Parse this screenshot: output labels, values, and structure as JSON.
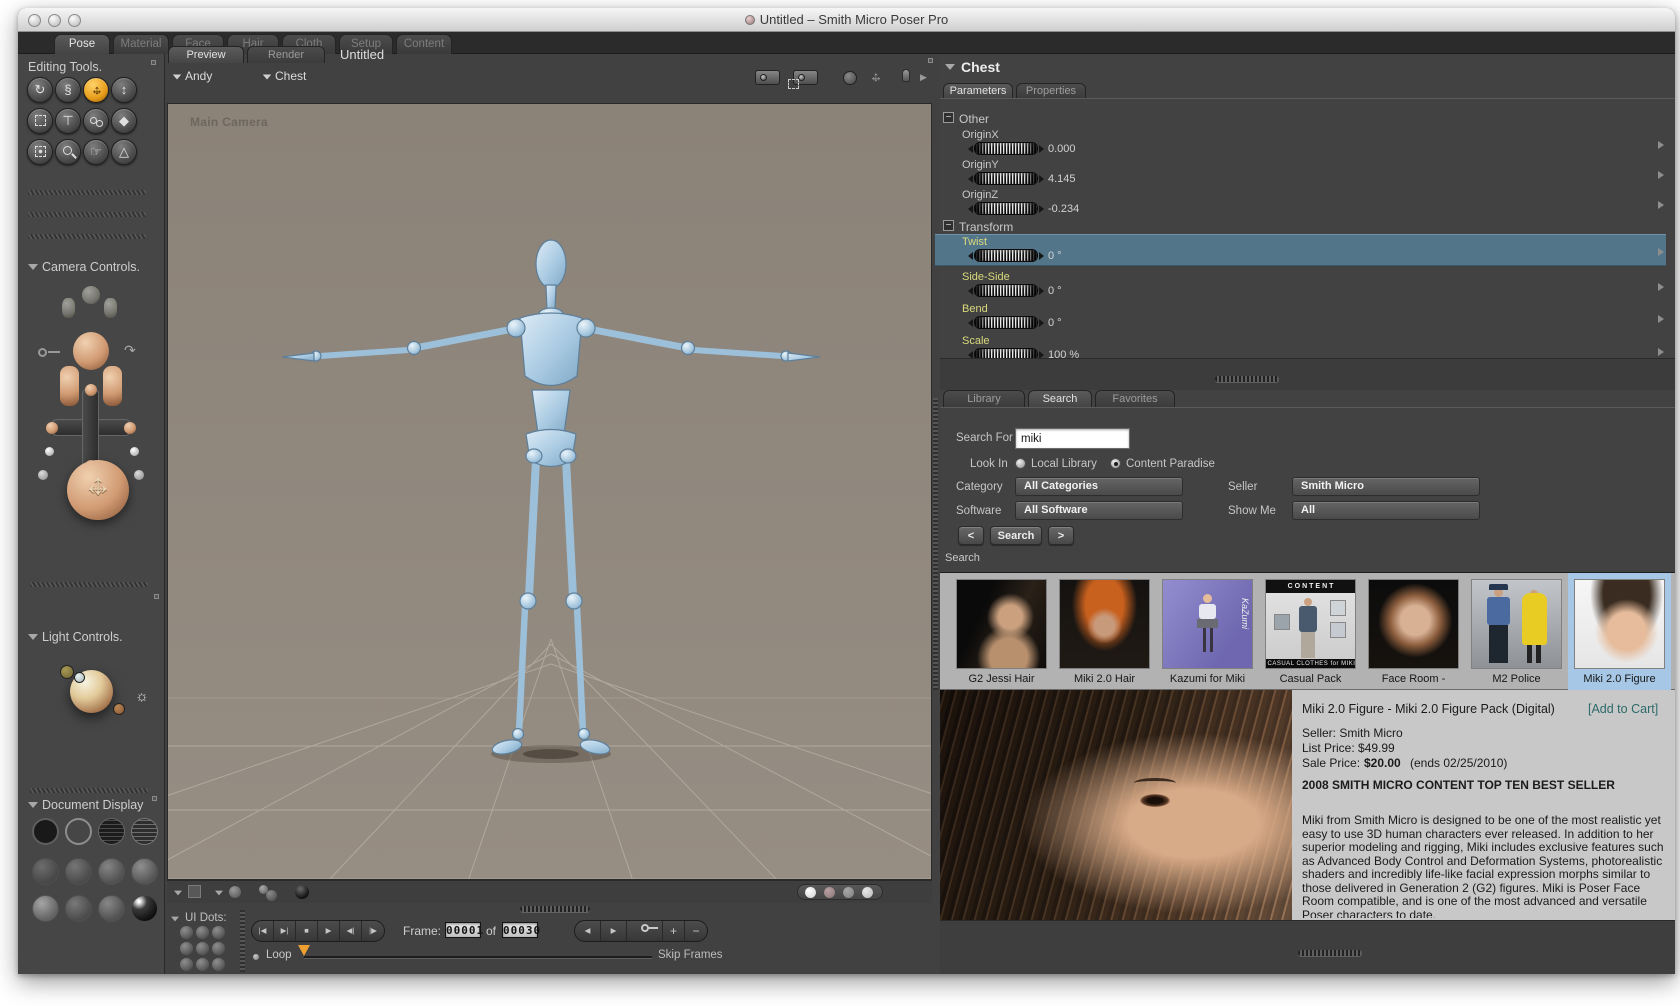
{
  "window": {
    "title": "Untitled – Smith Micro Poser Pro"
  },
  "main_tabs": [
    {
      "label": "Pose"
    },
    {
      "label": "Material"
    },
    {
      "label": "Face"
    },
    {
      "label": "Hair"
    },
    {
      "label": "Cloth"
    },
    {
      "label": "Setup"
    },
    {
      "label": "Content"
    }
  ],
  "sidebar": {
    "editing_tools": "Editing Tools.",
    "camera_controls": "Camera Controls.",
    "light_controls": "Light Controls.",
    "document_display": "Document Display"
  },
  "document": {
    "tab_preview": "Preview",
    "tab_render": "Render",
    "title": "Untitled",
    "actor": "Andy",
    "body_part": "Chest",
    "camera_label": "Main Camera"
  },
  "parameters": {
    "header": "Chest",
    "tab_parameters": "Parameters",
    "tab_properties": "Properties",
    "section_other": "Other",
    "section_transform": "Transform",
    "rows": [
      {
        "label": "OriginX",
        "value": "0.000"
      },
      {
        "label": "OriginY",
        "value": "4.145"
      },
      {
        "label": "OriginZ",
        "value": "-0.234"
      },
      {
        "label": "Twist",
        "value": "0 °"
      },
      {
        "label": "Side-Side",
        "value": "0 °"
      },
      {
        "label": "Bend",
        "value": "0 °"
      },
      {
        "label": "Scale",
        "value": "100 %"
      }
    ]
  },
  "library": {
    "tab_library": "Library",
    "tab_search": "Search",
    "tab_favorites": "Favorites",
    "search_for_label": "Search For",
    "search_value": "miki",
    "look_in_label": "Look In",
    "radio_local": "Local Library",
    "radio_paradise": "Content Paradise",
    "category_label": "Category",
    "category_value": "All Categories",
    "seller_label": "Seller",
    "seller_value": "Smith Micro",
    "software_label": "Software",
    "software_value": "All Software",
    "show_me_label": "Show Me",
    "show_me_value": "All",
    "prev_label": "<",
    "search_button": "Search",
    "next_label": ">",
    "results_header": "Search"
  },
  "results": [
    {
      "label": "G2 Jessi Hair"
    },
    {
      "label": "Miki 2.0 Hair"
    },
    {
      "label": "Kazumi for Miki",
      "overlay": "KaZumi"
    },
    {
      "label": "Casual Pack",
      "card_header": "CONTENT",
      "card_caption": "CASUAL CLOTHES for MIKI"
    },
    {
      "label": "Face Room -"
    },
    {
      "label": "M2 Police"
    },
    {
      "label": "Miki 2.0 Figure"
    }
  ],
  "detail": {
    "title": "Miki 2.0 Figure - Miki 2.0 Figure Pack (Digital)",
    "add_to_cart": "[Add to Cart]",
    "seller": "Seller: Smith Micro",
    "list_price": "List Price: $49.99",
    "sale_label": "Sale Price:",
    "sale_amount": "$20.00",
    "sale_ends": "(ends 02/25/2010)",
    "banner": "2008 SMITH MICRO CONTENT TOP TEN BEST SELLER",
    "description": "Miki from Smith Micro is designed to be one of the most realistic yet easy to use 3D human characters ever released. In addition to her superior modeling and rigging, Miki includes exclusive features such as Advanced Body Control and Deformation Systems, photorealistic shaders and incredibly life-like facial expression morphs similar to those delivered in Generation 2 (G2) figures. Miki is Poser Face Room compatible, and is one of the most advanced and versatile Poser characters to date."
  },
  "animation": {
    "ui_dots": "UI Dots:",
    "frame_label": "Frame:",
    "frame_current": "00001",
    "frame_of": "of",
    "frame_total": "00030",
    "loop_label": "Loop",
    "skip_frames": "Skip Frames"
  },
  "icons": {
    "disclosure": "▼",
    "first": "|◀",
    "last": "▶|",
    "stop": "■",
    "play": "▶",
    "step_back": "◀|",
    "step_fwd": "|▶",
    "left": "◀",
    "right": "▶",
    "plus": "+",
    "minus": "−",
    "sun": "☼",
    "rotate": "↻",
    "twist": "§",
    "arrow_h": "↔",
    "arrow_v": "↕",
    "taper": "⊤",
    "paint": "◆",
    "hand": "☞",
    "pivot": "△",
    "curve": "↷"
  },
  "colors": {
    "accent_orange": "#e89c1a",
    "selection_blue": "#53758a",
    "param_yellow": "#d9d97c",
    "link_teal": "#2d6a6a",
    "thumb_selected": "#a6c8e6"
  }
}
